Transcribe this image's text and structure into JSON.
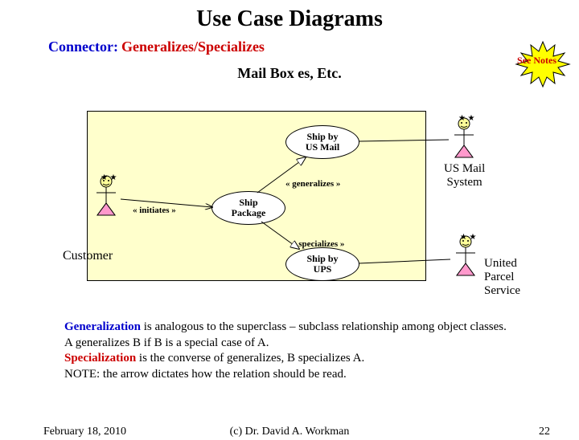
{
  "title": "Use Case Diagrams",
  "subtitle_label": "Connector:",
  "subtitle_value": "Generalizes/Specializes",
  "see_notes": "See Notes",
  "diagram_title": "Mail Box es, Etc.",
  "usecases": {
    "ship_by_us_mail": "Ship by\nUS Mail",
    "ship_package": "Ship\nPackage",
    "ship_by_ups": "Ship by\nUPS"
  },
  "labels": {
    "initiates": "« initiates »",
    "generalizes": "« generalizes »",
    "specializes": "« specializes »"
  },
  "actors": {
    "customer": "Customer",
    "us_mail": "US Mail\nSystem",
    "ups": "United\nParcel\nService"
  },
  "explanation": {
    "gen": "Generalization",
    "gen_rest": "  is analogous to the superclass – subclass relationship among object classes.  A generalizes B if B is a special case of A.",
    "spec": "Specialization",
    "spec_rest": " is the converse of generalizes,  B specializes A.",
    "note": "NOTE: the arrow dictates how the relation should be read."
  },
  "footer": {
    "date": "February 18, 2010",
    "copyright": "(c) Dr. David A. Workman",
    "page": "22"
  }
}
